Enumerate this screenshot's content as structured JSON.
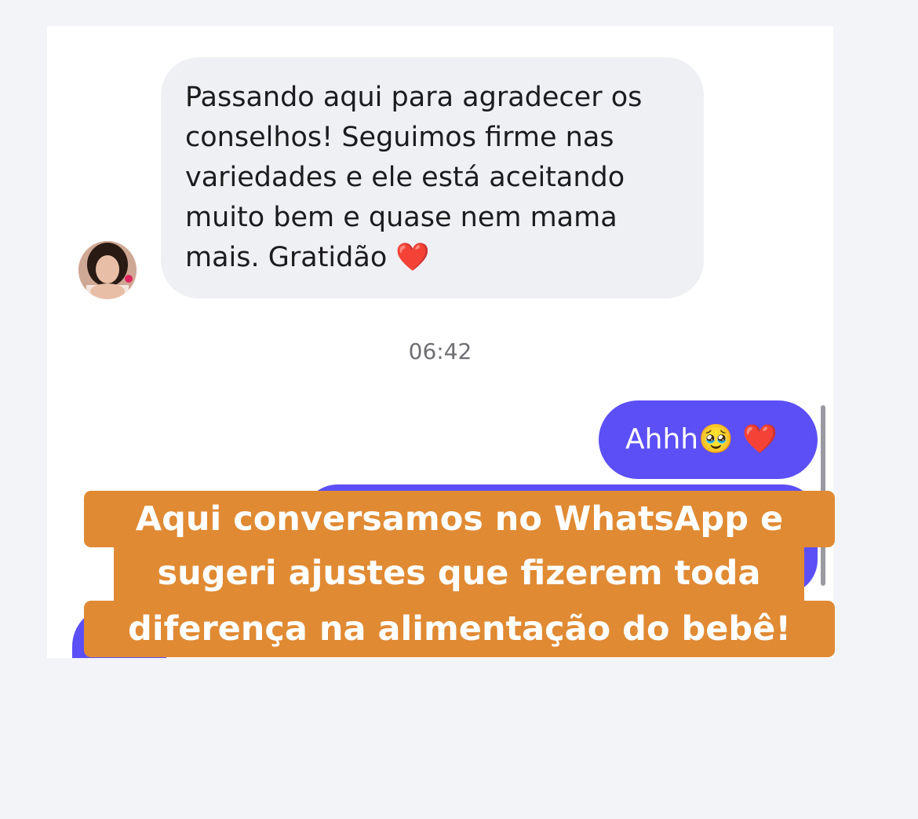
{
  "chat": {
    "incoming_message": "Passando aqui para agradecer os\nconselhos! Seguimos firme nas\nvariedades e ele está aceitando\nmuito bem e quase nem mama\nmais. Gratidão ❤️",
    "timestamp": "06:42",
    "outgoing_message": "Ahhh🥹 ❤️"
  },
  "caption": {
    "line1": "Aqui conversamos no WhatsApp e",
    "line2": "sugeri ajustes que fizerem toda",
    "line3": "diferença na alimentação do bebê!"
  },
  "colors": {
    "outgoing_bubble": "#5b4ff5",
    "incoming_bubble": "#eff0f3",
    "caption_background": "#e08a33"
  }
}
